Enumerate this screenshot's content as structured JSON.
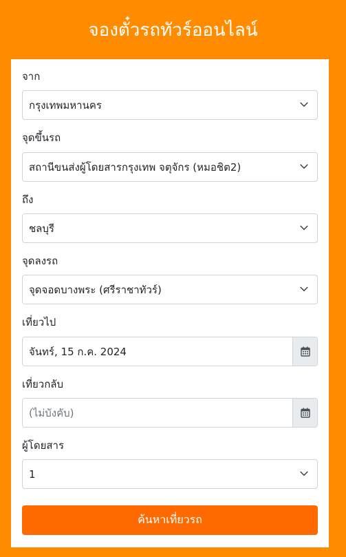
{
  "header": {
    "title": "จองตั๋วรถทัวร์ออนไลน์"
  },
  "form": {
    "from": {
      "label": "จาก",
      "value": "กรุงเทพมหานคร"
    },
    "boarding_point": {
      "label": "จุดขึ้นรถ",
      "value": "สถานีขนส่งผู้โดยสารกรุงเทพ จตุจักร (หมอชิต2)"
    },
    "to": {
      "label": "ถึง",
      "value": "ชลบุรี"
    },
    "dropoff_point": {
      "label": "จุดลงรถ",
      "value": "จุดจอดบางพระ (ศรีราชาทัวร์)"
    },
    "depart": {
      "label": "เที่ยวไป",
      "value": "จันทร์, 15 ก.ค. 2024"
    },
    "return": {
      "label": "เที่ยวกลับ",
      "placeholder": "(ไม่บังคับ)"
    },
    "passengers": {
      "label": "ผู้โดยสาร",
      "value": "1"
    },
    "submit_label": "ค้นหาเที่ยวรถ"
  },
  "icons": {
    "dropdown": "chevron-down-icon",
    "date": "calendar-icon"
  },
  "colors": {
    "background": "#ff8c00",
    "button": "#ff6a00",
    "panel": "#ffffff"
  }
}
